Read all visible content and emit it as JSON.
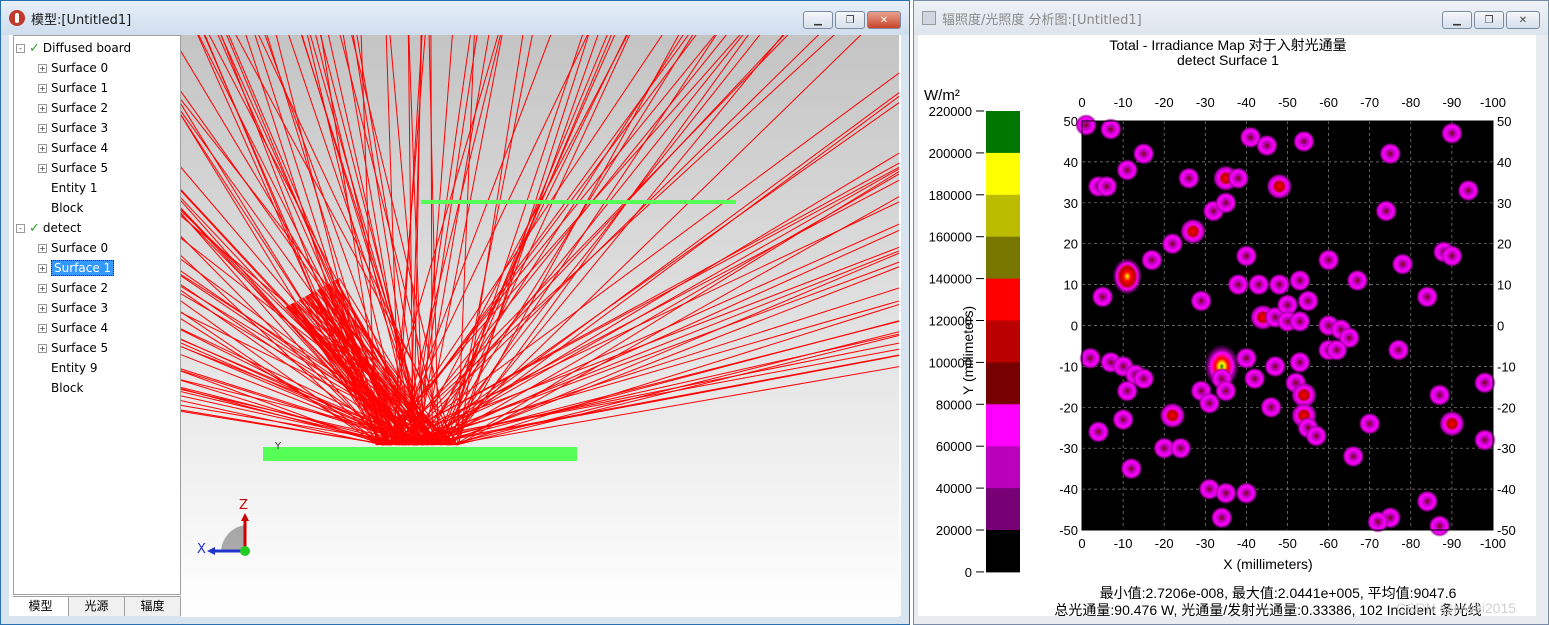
{
  "model_window": {
    "title": "模型:[Untitled1]",
    "tree": [
      {
        "label": "Diffused board",
        "level": 0,
        "expander": "-",
        "check": true
      },
      {
        "label": "Surface 0",
        "level": 1,
        "expander": "+"
      },
      {
        "label": "Surface 1",
        "level": 1,
        "expander": "+"
      },
      {
        "label": "Surface 2",
        "level": 1,
        "expander": "+"
      },
      {
        "label": "Surface 3",
        "level": 1,
        "expander": "+"
      },
      {
        "label": "Surface 4",
        "level": 1,
        "expander": "+"
      },
      {
        "label": "Surface 5",
        "level": 1,
        "expander": "+"
      },
      {
        "label": "Entity 1",
        "level": 1,
        "expander": ""
      },
      {
        "label": "Block",
        "level": 1,
        "expander": ""
      },
      {
        "label": "detect",
        "level": 0,
        "expander": "-",
        "check": true
      },
      {
        "label": "Surface 0",
        "level": 1,
        "expander": "+"
      },
      {
        "label": "Surface 1",
        "level": 1,
        "expander": "+",
        "selected": true
      },
      {
        "label": "Surface 2",
        "level": 1,
        "expander": "+"
      },
      {
        "label": "Surface 3",
        "level": 1,
        "expander": "+"
      },
      {
        "label": "Surface 4",
        "level": 1,
        "expander": "+"
      },
      {
        "label": "Surface 5",
        "level": 1,
        "expander": "+"
      },
      {
        "label": "Entity 9",
        "level": 1,
        "expander": ""
      },
      {
        "label": "Block",
        "level": 1,
        "expander": ""
      }
    ],
    "tabs": [
      "模型",
      "光源",
      "辐度"
    ],
    "axes": {
      "z": "Z",
      "x": "X",
      "y": "Y"
    },
    "colors": {
      "ray": "#ff0000",
      "board": "#55ff55"
    }
  },
  "map_window": {
    "title": "辐照度/光照度 分析图:[Untitled1]",
    "title_line1": "Total - Irradiance Map 对于入射光通量",
    "title_line2": "detect Surface 1",
    "unit": "W/m²",
    "y_axis_label": "Y (millimeters)",
    "x_axis_label": "X (millimeters)",
    "stats_line1": "最小值:2.7206e-008, 最大值:2.0441e+005, 平均值:9047.6",
    "stats_line2": "总光通量:90.476 W, 光通量/发射光通量:0.33386, 102 Incident 条光线",
    "watermark": "CSDN @lvwei2015"
  },
  "chart_data": {
    "type": "heatmap",
    "title": "Total - Irradiance Map 对于入射光通量",
    "subtitle": "detect Surface 1",
    "xlabel": "X (millimeters)",
    "ylabel": "Y (millimeters)",
    "x_ticks": [
      0,
      -10,
      -20,
      -30,
      -40,
      -50,
      -60,
      -70,
      -80,
      -90,
      -100
    ],
    "y_ticks": [
      50,
      40,
      30,
      20,
      10,
      0,
      -10,
      -20,
      -30,
      -40,
      -50
    ],
    "xlim": [
      0,
      -100
    ],
    "ylim": [
      -50,
      50
    ],
    "colorbar": {
      "unit": "W/m²",
      "ticks": [
        220000,
        200000,
        180000,
        160000,
        140000,
        120000,
        100000,
        80000,
        60000,
        40000,
        20000,
        0
      ],
      "colors": [
        "#007700",
        "#ffff00",
        "#bbbb00",
        "#777700",
        "#ff0000",
        "#bb0000",
        "#770000",
        "#ff00ff",
        "#bb00bb",
        "#770077",
        "#000000"
      ]
    },
    "min": "2.7206e-008",
    "max": "2.0441e+005",
    "mean": 9047.6,
    "spots": [
      [
        -1,
        49,
        0
      ],
      [
        -7,
        48,
        0
      ],
      [
        -15,
        42,
        0
      ],
      [
        -11,
        38,
        0
      ],
      [
        -26,
        36,
        0
      ],
      [
        -35,
        36,
        1
      ],
      [
        -38,
        36,
        0
      ],
      [
        -41,
        46,
        0
      ],
      [
        -45,
        44,
        0
      ],
      [
        -54,
        45,
        0
      ],
      [
        -48,
        34,
        1
      ],
      [
        -75,
        42,
        0
      ],
      [
        -90,
        47,
        0
      ],
      [
        -94,
        33,
        0
      ],
      [
        -74,
        28,
        0
      ],
      [
        -4,
        34,
        0
      ],
      [
        -6,
        34,
        0
      ],
      [
        -32,
        28,
        0
      ],
      [
        -35,
        30,
        0
      ],
      [
        -27,
        23,
        1
      ],
      [
        -22,
        20,
        0
      ],
      [
        -40,
        17,
        0
      ],
      [
        -17,
        16,
        0
      ],
      [
        -11,
        12,
        2
      ],
      [
        -5,
        7,
        0
      ],
      [
        -29,
        6,
        0
      ],
      [
        -38,
        10,
        0
      ],
      [
        -43,
        10,
        0
      ],
      [
        -48,
        10,
        0
      ],
      [
        -53,
        11,
        0
      ],
      [
        -55,
        6,
        0
      ],
      [
        -60,
        16,
        0
      ],
      [
        -67,
        11,
        0
      ],
      [
        -78,
        15,
        0
      ],
      [
        -88,
        18,
        0
      ],
      [
        -90,
        17,
        0
      ],
      [
        -84,
        7,
        0
      ],
      [
        -44,
        2,
        1
      ],
      [
        -47,
        2,
        0
      ],
      [
        -50,
        5,
        0
      ],
      [
        -50,
        1,
        0
      ],
      [
        -53,
        1,
        0
      ],
      [
        -60,
        0,
        0
      ],
      [
        -63,
        -1,
        0
      ],
      [
        -65,
        -3,
        0
      ],
      [
        -60,
        -6,
        0
      ],
      [
        -62,
        -6,
        0
      ],
      [
        -53,
        -9,
        0
      ],
      [
        -77,
        -6,
        0
      ],
      [
        -2,
        -8,
        0
      ],
      [
        -7,
        -9,
        0
      ],
      [
        -10,
        -10,
        0
      ],
      [
        -13,
        -12,
        0
      ],
      [
        -15,
        -13,
        0
      ],
      [
        -11,
        -16,
        0
      ],
      [
        -34,
        -10,
        3
      ],
      [
        -34,
        -13,
        0
      ],
      [
        -40,
        -8,
        0
      ],
      [
        -42,
        -13,
        0
      ],
      [
        -47,
        -10,
        0
      ],
      [
        -46,
        -20,
        0
      ],
      [
        -29,
        -16,
        0
      ],
      [
        -31,
        -19,
        0
      ],
      [
        -35,
        -16,
        0
      ],
      [
        -52,
        -14,
        0
      ],
      [
        -54,
        -17,
        1
      ],
      [
        -54,
        -22,
        1
      ],
      [
        -55,
        -25,
        0
      ],
      [
        -57,
        -27,
        0
      ],
      [
        -22,
        -22,
        1
      ],
      [
        -10,
        -23,
        0
      ],
      [
        -4,
        -26,
        0
      ],
      [
        -70,
        -24,
        0
      ],
      [
        -87,
        -17,
        0
      ],
      [
        -90,
        -24,
        1
      ],
      [
        -98,
        -14,
        0
      ],
      [
        -98,
        -28,
        0
      ],
      [
        -20,
        -30,
        0
      ],
      [
        -24,
        -30,
        0
      ],
      [
        -12,
        -35,
        0
      ],
      [
        -66,
        -32,
        0
      ],
      [
        -31,
        -40,
        0
      ],
      [
        -35,
        -41,
        0
      ],
      [
        -40,
        -41,
        0
      ],
      [
        -34,
        -47,
        0
      ],
      [
        -75,
        -47,
        0
      ],
      [
        -72,
        -48,
        0
      ],
      [
        -84,
        -43,
        0
      ],
      [
        -87,
        -49,
        0
      ]
    ]
  }
}
